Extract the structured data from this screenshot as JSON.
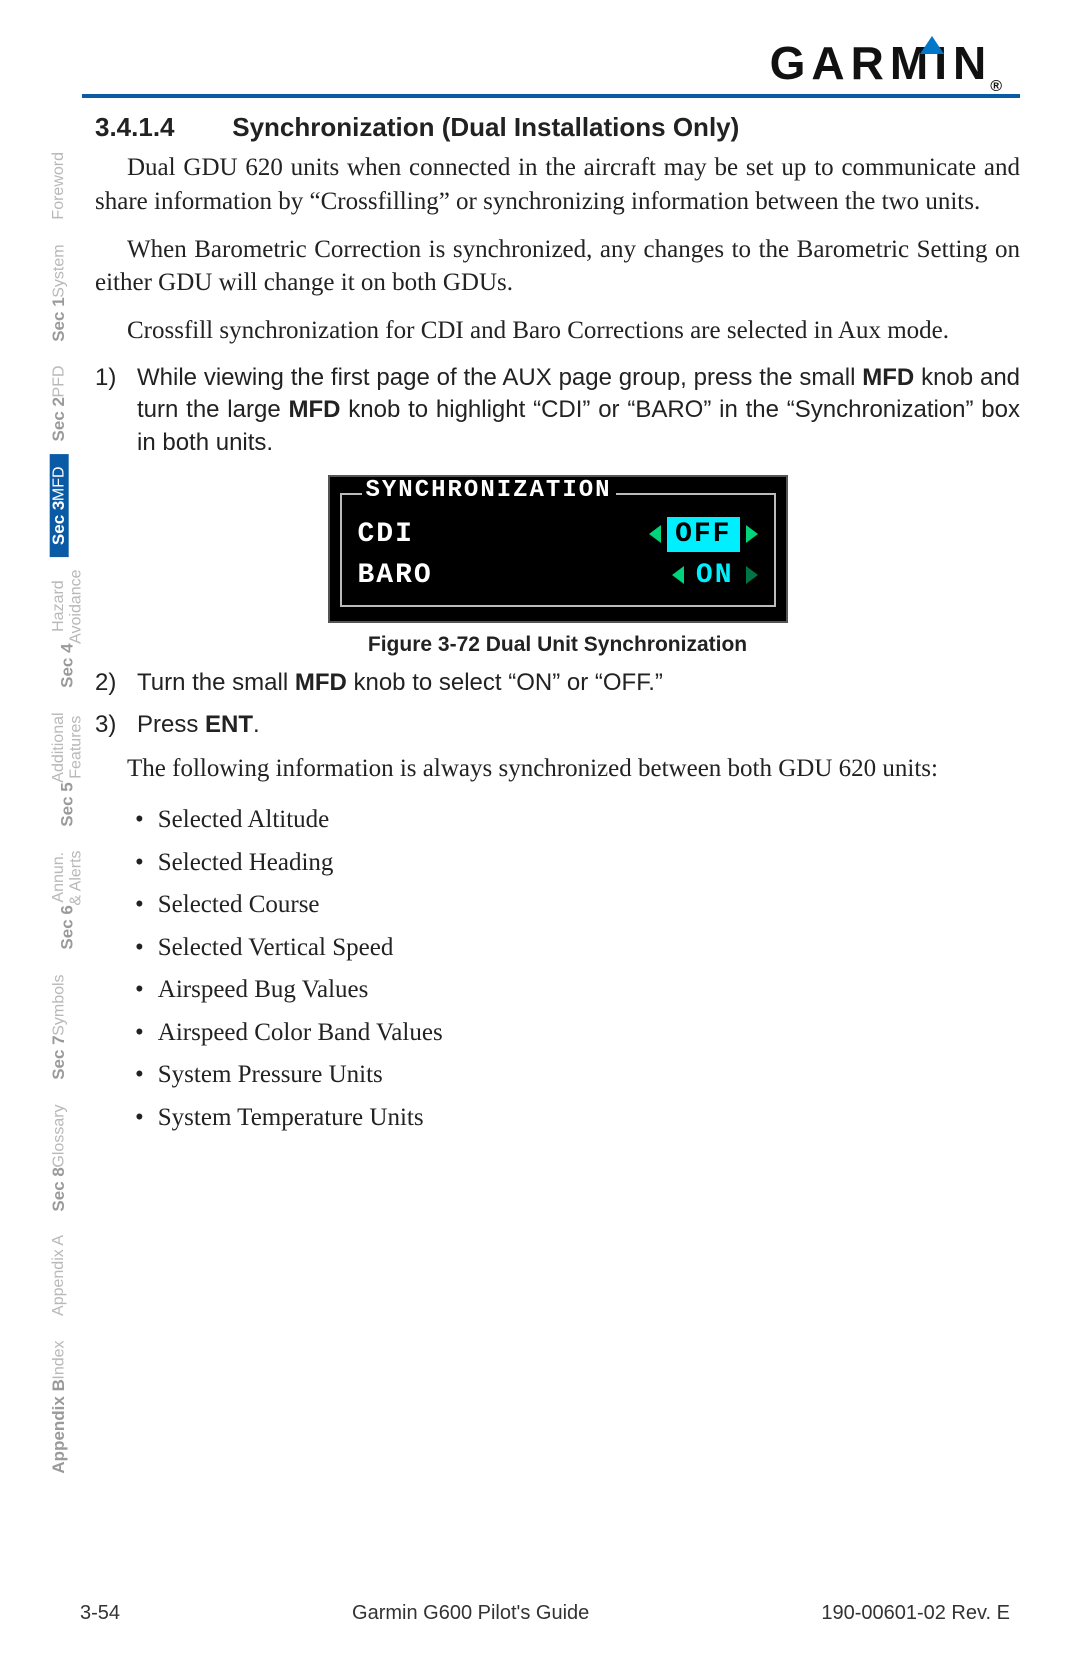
{
  "brand": {
    "name": "GARMIN",
    "reg": "®"
  },
  "tabs": [
    {
      "main": "",
      "sub": "Foreword",
      "active": false
    },
    {
      "main": "Sec 1",
      "sub": "System",
      "active": false
    },
    {
      "main": "Sec 2",
      "sub": "PFD",
      "active": false
    },
    {
      "main": "Sec 3",
      "sub": "MFD",
      "active": true
    },
    {
      "main": "Sec 4",
      "sub": "Hazard\nAvoidance",
      "active": false
    },
    {
      "main": "Sec 5",
      "sub": "Additional\nFeatures",
      "active": false
    },
    {
      "main": "Sec 6",
      "sub": "Annun.\n& Alerts",
      "active": false
    },
    {
      "main": "Sec 7",
      "sub": "Symbols",
      "active": false
    },
    {
      "main": "Sec 8",
      "sub": "Glossary",
      "active": false
    },
    {
      "main": "",
      "sub": "Appendix A",
      "active": false
    },
    {
      "main": "Appendix B",
      "sub": "Index",
      "active": false
    }
  ],
  "heading": {
    "num": "3.4.1.4",
    "title": "Synchronization (Dual Installations Only)"
  },
  "paras": {
    "p1": "Dual GDU 620 units when connected in the aircraft may be set up to communicate and share information by “Crossfilling” or synchronizing information between the two units.",
    "p2": "When Barometric Correction is synchronized, any changes to the Barometric Setting on either GDU will change it on both GDUs.",
    "p3": "Crossfill synchronization for CDI and Baro Corrections are selected in Aux mode.",
    "p4": "The following information is always synchronized between both GDU 620 units:"
  },
  "steps": {
    "s1_pre": "While viewing the first page of the AUX page group, press the small ",
    "s1_b1": "MFD",
    "s1_mid": " knob and turn the large ",
    "s1_b2": "MFD",
    "s1_post": " knob to highlight “CDI” or “BARO” in the “Synchronization” box in both units.",
    "s2_pre": "Turn the small ",
    "s2_b1": "MFD",
    "s2_post": " knob to select “ON” or “OFF.”",
    "s3_pre": "Press ",
    "s3_b1": "ENT",
    "s3_post": "."
  },
  "nums": {
    "n1": "1)",
    "n2": "2)",
    "n3": "3)"
  },
  "figure": {
    "title": "SYNCHRONIZATION",
    "rows": [
      {
        "label": "CDI",
        "value": "OFF",
        "selected": true
      },
      {
        "label": "BARO",
        "value": "ON",
        "selected": false
      }
    ],
    "caption": "Figure 3-72  Dual Unit Synchronization"
  },
  "bullets": [
    "Selected Altitude",
    "Selected Heading",
    "Selected Course",
    "Selected Vertical Speed",
    "Airspeed Bug Values",
    "Airspeed Color Band Values",
    "System Pressure Units",
    "System Temperature Units"
  ],
  "footer": {
    "page": "3-54",
    "center": "Garmin G600 Pilot's Guide",
    "right": "190-00601-02  Rev. E"
  }
}
